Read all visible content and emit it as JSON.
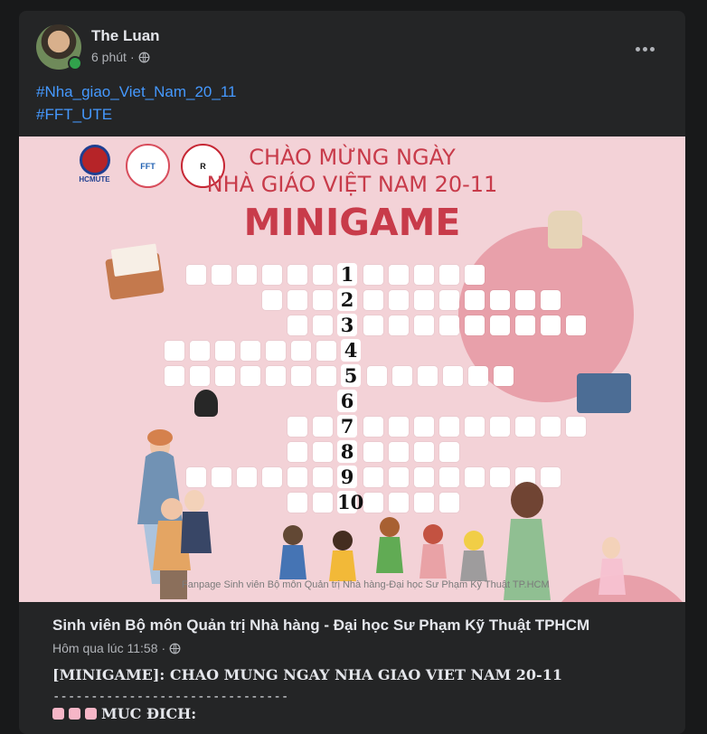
{
  "post": {
    "author": "The Luan",
    "time": "6 phút",
    "separator": "·",
    "hashtags": [
      "#Nha_giao_Viet_Nam_20_11",
      "#FFT_UTE"
    ],
    "privacy_icon": "globe-icon",
    "more_icon": "more-icon"
  },
  "image": {
    "logo_1_label": "HCMUTE",
    "logo_2_label": "FFT",
    "logo_3_label": "R",
    "heading": {
      "line1": "CHÀO MỪNG NGÀY",
      "line2": "NHÀ GIÁO VIỆT NAM 20-11",
      "line3": "MINIGAME"
    },
    "footer": "Fanpage Sinh viên Bộ môn Quản trị Nhà hàng-Đại học Sư Phạm Kỹ Thuật TP.HCM",
    "numbers": [
      "1",
      "2",
      "3",
      "4",
      "5",
      "6",
      "7",
      "8",
      "9",
      "10"
    ]
  },
  "shared": {
    "page": "Sinh viên Bộ môn Quản trị Nhà hàng - Đại học Sư Phạm Kỹ Thuật TPHCM",
    "time": "Hôm qua lúc 11:58",
    "title": "[MINIGAME]: CHAO MUNG NGAY NHA GIAO VIET NAM 20-11",
    "divider": "-------------------------------",
    "purpose": "MUC ĐICH:"
  },
  "colors": {
    "background": "#18191a",
    "card": "#242526",
    "link": "#4599ff",
    "image_bg": "#f3d2d7",
    "accent": "#c83b4a"
  }
}
